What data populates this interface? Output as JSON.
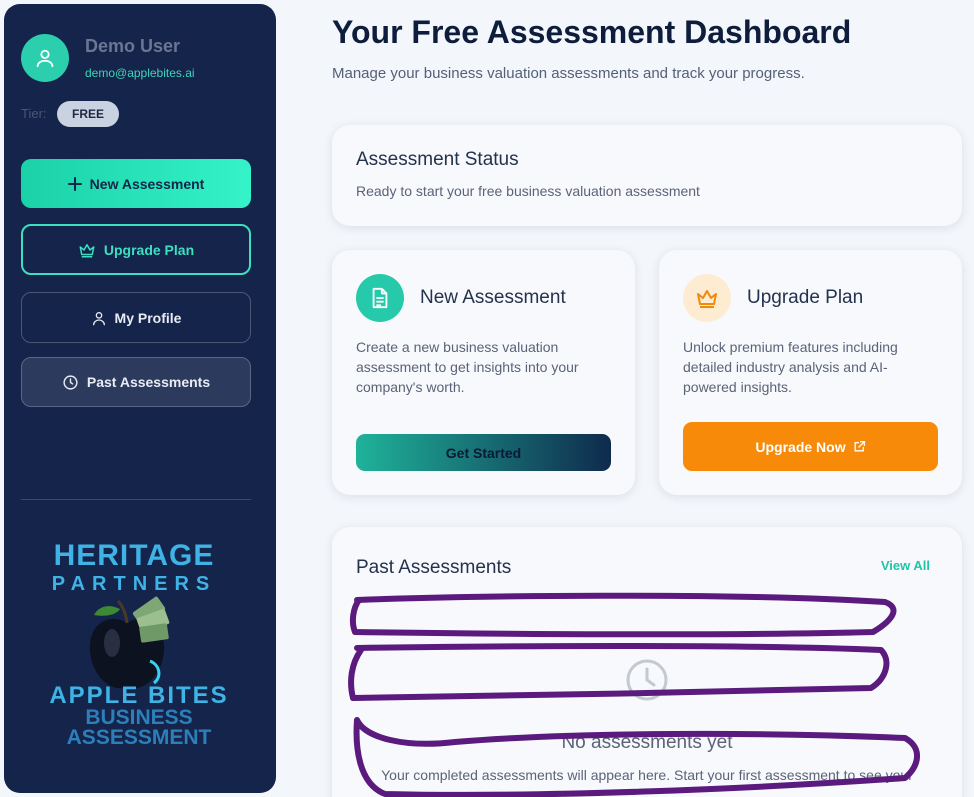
{
  "sidebar": {
    "user_name": "Demo User",
    "user_email": "demo@applebites.ai",
    "tier_label": "Tier:",
    "tier_value": "FREE",
    "buttons": {
      "new_assessment": "New Assessment",
      "upgrade_plan": "Upgrade Plan",
      "my_profile": "My Profile",
      "past_assessments": "Past Assessments"
    },
    "logo": {
      "line1": "HERITAGE",
      "line2": "PARTNERS",
      "line3": "APPLE BITES",
      "line4": "BUSINESS",
      "line5": "ASSESSMENT"
    }
  },
  "main": {
    "title": "Your Free Assessment Dashboard",
    "subtitle": "Manage your business valuation assessments and track your progress.",
    "status": {
      "title": "Assessment Status",
      "text": "Ready to start your free business valuation assessment"
    },
    "new_assessment_card": {
      "title": "New Assessment",
      "description": "Create a new business valuation assessment to get insights into your company's worth.",
      "button": "Get Started"
    },
    "upgrade_card": {
      "title": "Upgrade Plan",
      "description": "Unlock premium features including detailed industry analysis and AI-powered insights.",
      "button": "Upgrade Now"
    },
    "past": {
      "title": "Past Assessments",
      "view_all": "View All",
      "empty_title": "No assessments yet",
      "empty_text": "Your completed assessments will appear here. Start your first assessment to see your"
    }
  },
  "colors": {
    "sidebar_bg": "#14244b",
    "accent_teal": "#2bcfae",
    "accent_orange": "#f78b09",
    "scribble_purple": "#5b1a7e"
  },
  "icons": [
    "user-icon",
    "plus-icon",
    "crown-icon",
    "person-icon",
    "clock-icon",
    "document-icon",
    "external-link-icon"
  ]
}
